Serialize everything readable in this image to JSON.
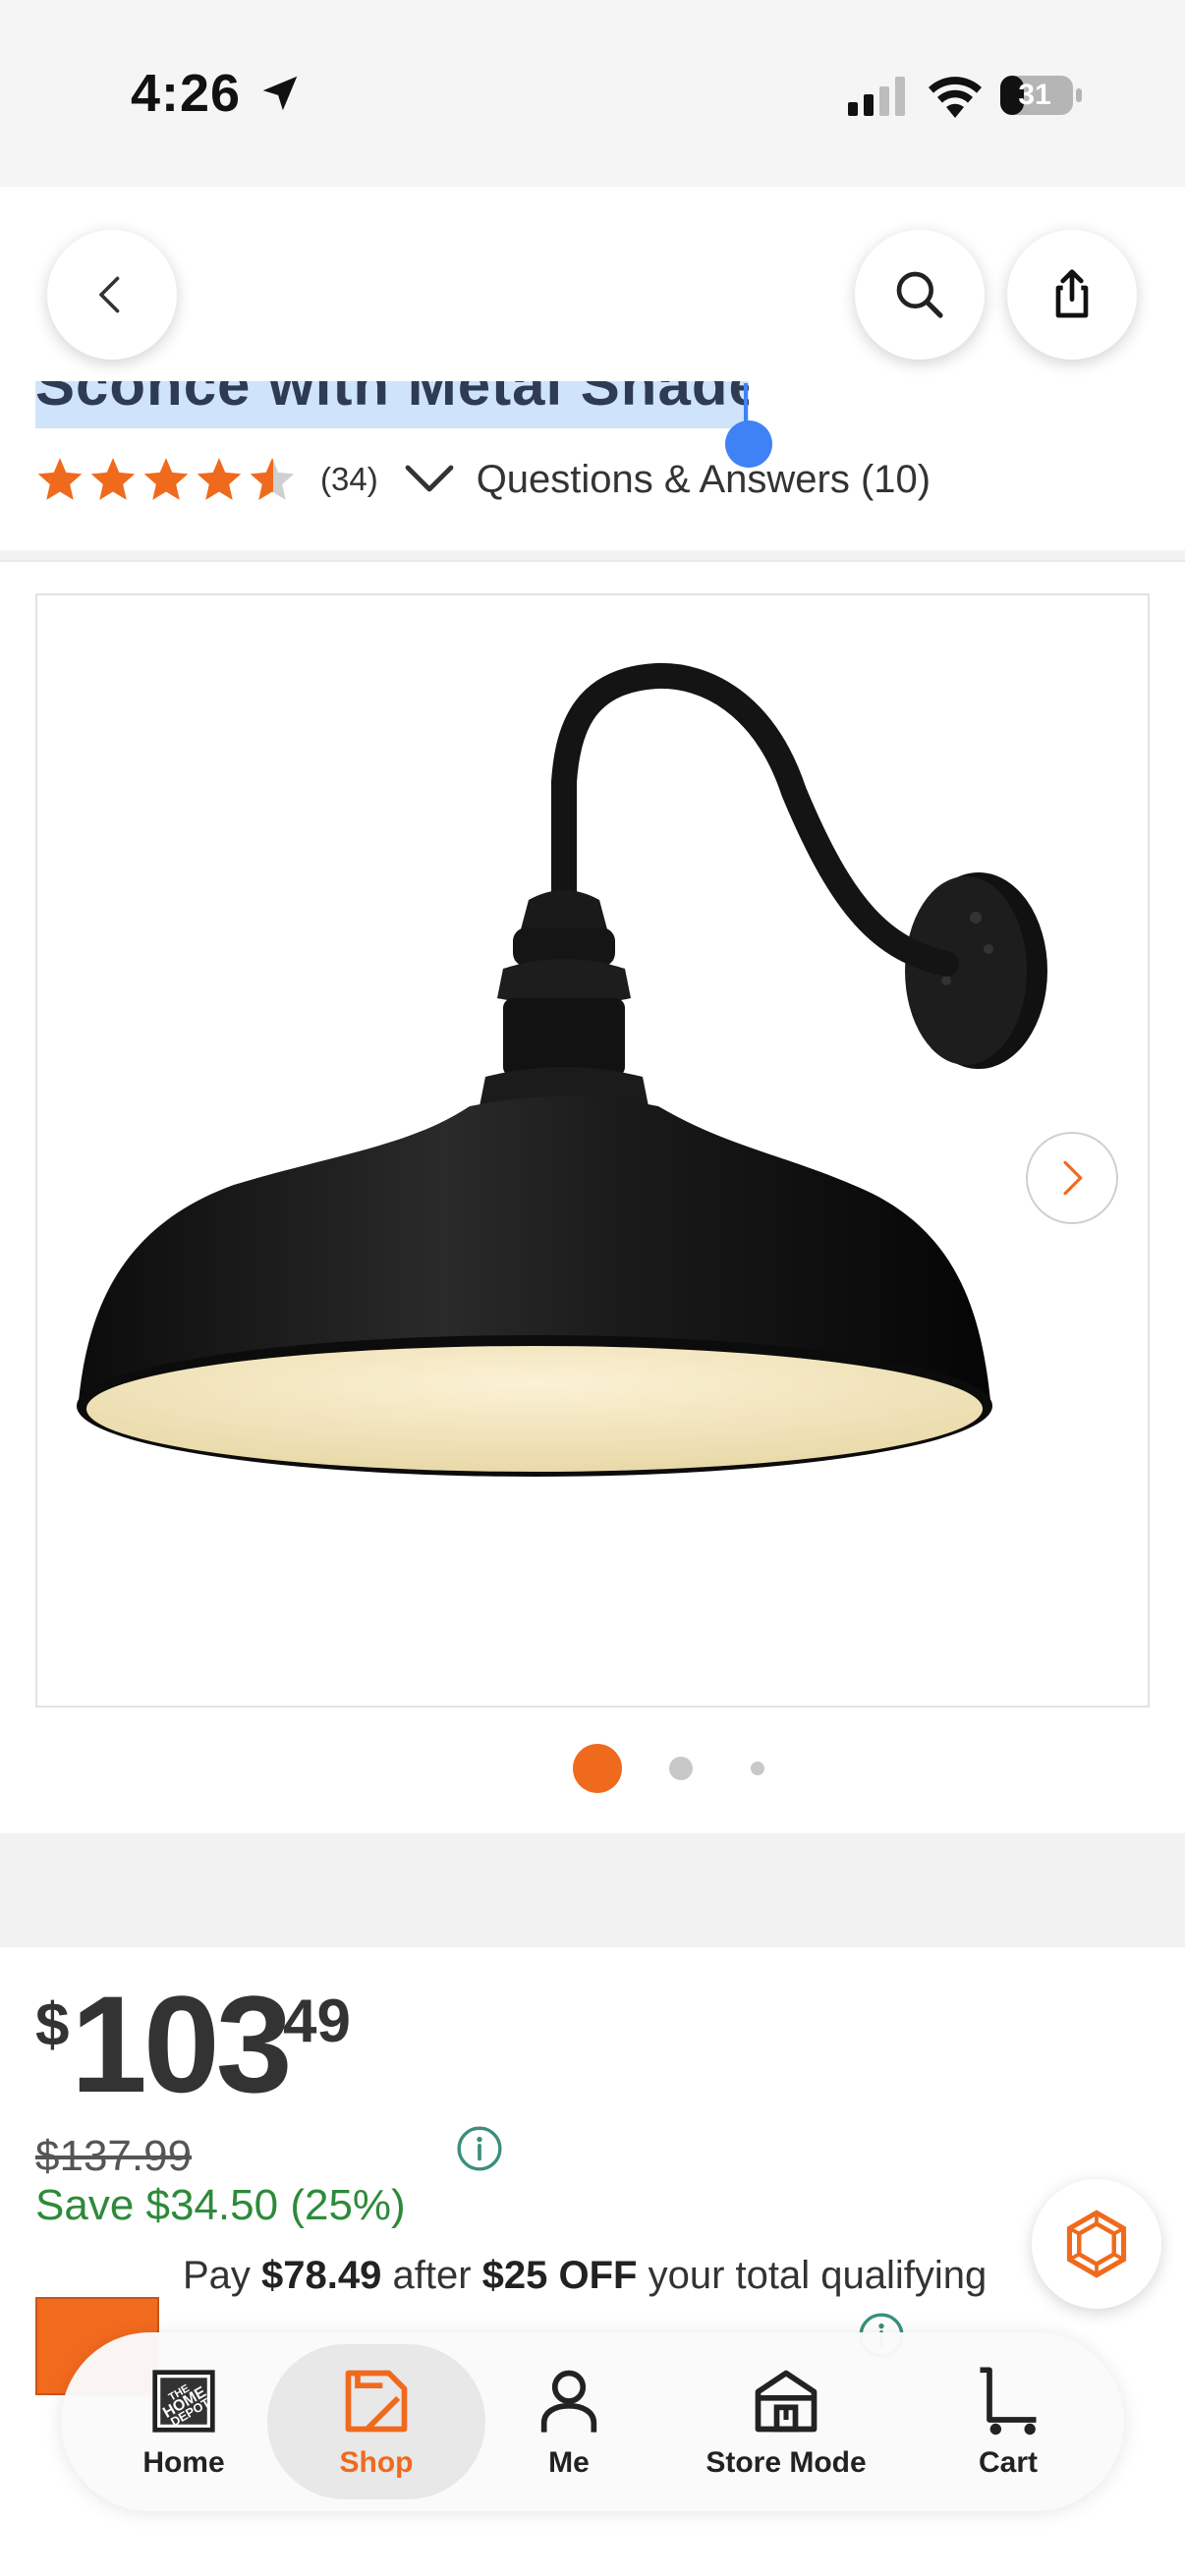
{
  "status_bar": {
    "time": "4:26",
    "battery": "31"
  },
  "product": {
    "title_fragment": "Sconce with Metal Shade",
    "review_count": "(34)",
    "rating": 4.5,
    "qa_link": "Questions & Answers (10)"
  },
  "gallery": {
    "image_count": 3,
    "active_index": 0
  },
  "price": {
    "dollar_sign": "$",
    "whole": "103",
    "cents": "49",
    "was": "$137.99",
    "savings": "Save $34.50 (25%)"
  },
  "promo": {
    "text_pre": "Pay ",
    "amount": "$78.49",
    "text_mid": " after ",
    "discount": "$25 OFF",
    "text_post": " your total qualifying"
  },
  "tabbar": {
    "home": "Home",
    "shop": "Shop",
    "me": "Me",
    "store_mode": "Store Mode",
    "cart": "Cart"
  },
  "colors": {
    "accent": "#f06a1d",
    "savings_green": "#2e8a3a",
    "selection_blue": "#3f82f6",
    "info_teal": "#3a8f7d"
  }
}
